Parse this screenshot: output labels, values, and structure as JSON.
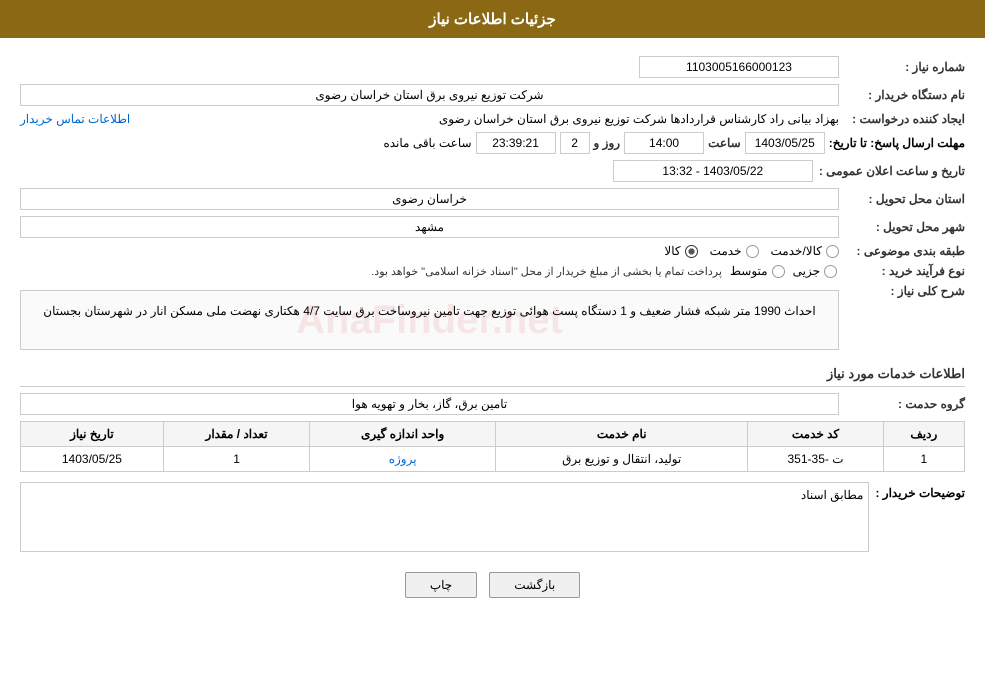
{
  "header": {
    "title": "جزئیات اطلاعات نیاز"
  },
  "fields": {
    "need_number_label": "شماره نیاز :",
    "need_number_value": "1103005166000123",
    "buyer_org_label": "نام دستگاه خریدار :",
    "buyer_org_value": "شرکت توزیع نیروی برق استان خراسان رضوی",
    "creator_label": "ایجاد کننده درخواست :",
    "creator_value": "بهزاد بیانی راد کارشناس قراردادها شرکت توزیع نیروی برق استان خراسان رضوی",
    "contact_link": "اطلاعات تماس خریدار",
    "deadline_label": "مهلت ارسال پاسخ: تا تاریخ:",
    "deadline_date": "1403/05/25",
    "deadline_time_label": "ساعت",
    "deadline_time": "14:00",
    "deadline_days_label": "روز و",
    "deadline_days": "2",
    "deadline_remaining": "23:39:21",
    "deadline_remaining_label": "ساعت باقی مانده",
    "province_label": "استان محل تحویل :",
    "province_value": "خراسان رضوی",
    "city_label": "شهر محل تحویل :",
    "city_value": "مشهد",
    "category_label": "طبقه بندی موضوعی :",
    "category_options": [
      {
        "label": "کالا",
        "selected": true
      },
      {
        "label": "خدمت",
        "selected": false
      },
      {
        "label": "کالا/خدمت",
        "selected": false
      }
    ],
    "purchase_type_label": "نوع فرآیند خرید :",
    "purchase_type_options": [
      {
        "label": "جزیی",
        "selected": false
      },
      {
        "label": "متوسط",
        "selected": false
      }
    ],
    "purchase_type_note": "پرداخت تمام یا بخشی از مبلغ خریدار از محل \"اسناد خزانه اسلامی\" خواهد بود.",
    "announcement_label": "تاریخ و ساعت اعلان عمومی :",
    "announcement_value": "1403/05/22 - 13:32",
    "description_label": "شرح کلی نیاز :",
    "description_text": "احداث 1990 متر شبکه فشار ضعیف و 1 دستگاه پست هوائی توزیع جهت تامین نیروساخت برق  سایت 4/7 هکتاری نهضت ملی مسکن انار در شهرستان بجستان",
    "services_section_label": "اطلاعات خدمات مورد نیاز",
    "service_group_label": "گروه حدمت :",
    "service_group_value": "تامین برق، گاز، بخار و تهویه هوا",
    "table": {
      "headers": [
        "ردیف",
        "کد خدمت",
        "نام خدمت",
        "واحد اندازه گیری",
        "تعداد / مقدار",
        "تاریخ نیاز"
      ],
      "rows": [
        {
          "row": "1",
          "code": "ت -35-351",
          "name": "تولید، انتقال و توزیع برق",
          "unit": "پروژه",
          "quantity": "1",
          "date": "1403/05/25"
        }
      ]
    },
    "buyer_notes_label": "توضیحات خریدار :",
    "buyer_notes_value": "مطابق اسناد"
  },
  "buttons": {
    "print": "چاپ",
    "back": "بازگشت"
  }
}
